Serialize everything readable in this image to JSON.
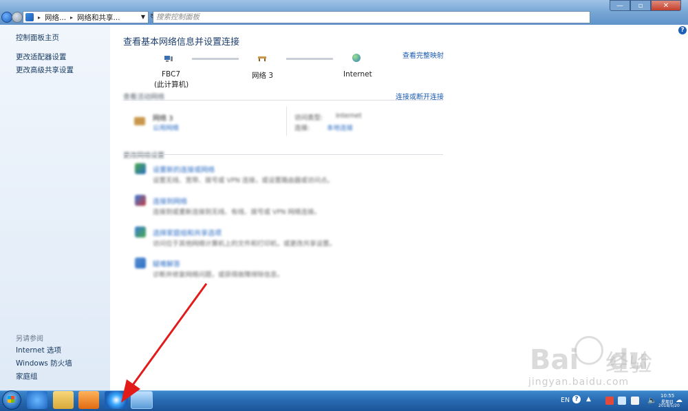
{
  "address": {
    "seg1": "网络...",
    "seg2": "网络和共享...",
    "search_placeholder": "搜索控制面板"
  },
  "window": {
    "min": "—",
    "max": "▫",
    "close": "✕"
  },
  "sidebar": {
    "items": [
      "控制面板主页",
      "更改适配器设置",
      "更改高级共享设置"
    ],
    "see_also": "另请参阅",
    "see_also_items": [
      "Internet 选项",
      "Windows 防火墙",
      "家庭组"
    ]
  },
  "main": {
    "title": "查看基本网络信息并设置连接",
    "full_map": "查看完整映射",
    "nodes": {
      "pc": "FBC7",
      "pc_sub": "(此计算机)",
      "network": "网络  3",
      "internet": "Internet"
    },
    "sec1_title": "查看活动网络",
    "sec1_link": "连接或断开连接",
    "active_net_name": "网络  3",
    "active_net_type": "公用网络",
    "access_label": "访问类型:",
    "access_value": "Internet",
    "conn_label": "连接:",
    "conn_value": "本地连接",
    "sec2_title": "更改网络设置",
    "tasks": [
      {
        "link": "设置新的连接或网络",
        "desc": "设置无线、宽带、拨号或 VPN 连接，或设置路由器或访问点。"
      },
      {
        "link": "连接到网络",
        "desc": "连接到或重新连接到无线、有线、拨号或 VPN 网络连接。"
      },
      {
        "link": "选择家庭组和共享选项",
        "desc": "访问位于其他网络计算机上的文件和打印机，或更改共享设置。"
      },
      {
        "link": "疑难解答",
        "desc": "诊断并修复网络问题，或获得故障排除信息。"
      }
    ]
  },
  "taskbar": {
    "lang": "EN",
    "help": "?",
    "clock_time": "10:55",
    "clock_day": "星期日",
    "clock_date": "2018/5/20"
  },
  "watermark": {
    "brand": "Bai",
    "brand2": "du",
    "jingyan": "经验",
    "url": "jingyan.baidu.com"
  },
  "colors": {
    "accent": "#1a5ab0",
    "arrow": "#e21a1a",
    "taskbar": "#2769b0"
  }
}
